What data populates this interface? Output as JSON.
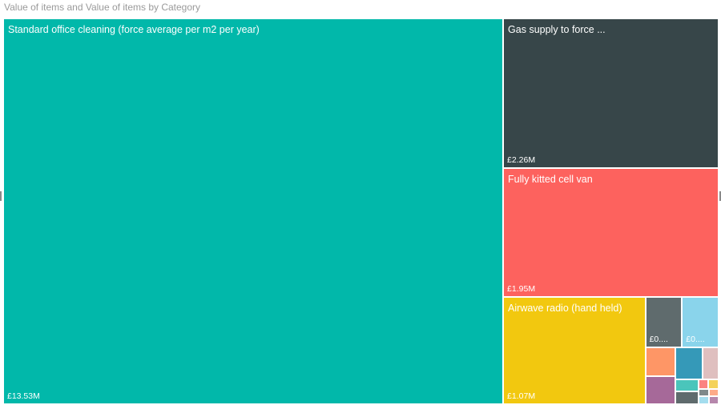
{
  "title": "Value of items and Value of items by Category",
  "chart_data": {
    "type": "treemap",
    "title": "Value of items and Value of items by Category",
    "unit": "£M",
    "items": [
      {
        "label": "Standard office cleaning (force average per m2 per year)",
        "value_text": "£13.53M",
        "value": 13.53,
        "color": "#01B8AA"
      },
      {
        "label": "Gas supply to force ...",
        "value_text": "£2.26M",
        "value": 2.26,
        "color": "#374649"
      },
      {
        "label": "Fully kitted cell van",
        "value_text": "£1.95M",
        "value": 1.95,
        "color": "#FD625E"
      },
      {
        "label": "Airwave radio (hand held)",
        "value_text": "£1.07M",
        "value": 1.07,
        "color": "#F2C80F"
      },
      {
        "label": "",
        "value_text": "£0....",
        "value": 0.13,
        "color": "#5F6B6D"
      },
      {
        "label": "",
        "value_text": "£0....",
        "value": 0.13,
        "color": "#8AD4EB"
      },
      {
        "label": "",
        "value_text": "",
        "value": 0.06,
        "color": "#FE9666"
      },
      {
        "label": "",
        "value_text": "",
        "value": 0.06,
        "color": "#A66999"
      },
      {
        "label": "",
        "value_text": "",
        "value": 0.06,
        "color": "#3599B8"
      },
      {
        "label": "",
        "value_text": "",
        "value": 0.035,
        "color": "#DFBFBF"
      },
      {
        "label": "",
        "value_text": "",
        "value": 0.02,
        "color": "#4AC5BB"
      },
      {
        "label": "",
        "value_text": "",
        "value": 0.02,
        "color": "#5F6B6D"
      },
      {
        "label": "",
        "value_text": "",
        "value": 0.007,
        "color": "#FB8281"
      },
      {
        "label": "",
        "value_text": "",
        "value": 0.007,
        "color": "#F4D25A"
      },
      {
        "label": "",
        "value_text": "",
        "value": 0.006,
        "color": "#7F898A"
      },
      {
        "label": "",
        "value_text": "",
        "value": 0.006,
        "color": "#A4DDEE"
      },
      {
        "label": "",
        "value_text": "",
        "value": 0.005,
        "color": "#FDAB89"
      },
      {
        "label": "",
        "value_text": "",
        "value": 0.005,
        "color": "#B687AC"
      }
    ]
  }
}
